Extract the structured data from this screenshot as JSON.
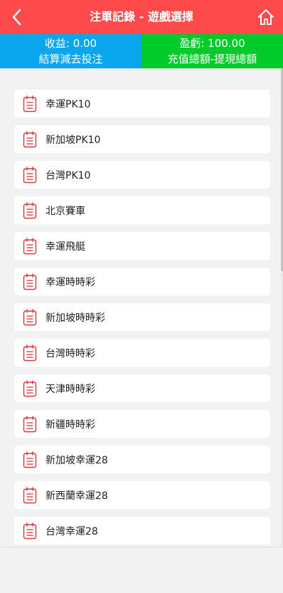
{
  "header": {
    "title": "注單記錄 - 遊戲選擇",
    "back_icon": "chevron-left-icon",
    "home_icon": "home-icon"
  },
  "stats": {
    "profit_label": "收益: 0.00",
    "profit_note": "結算減去投注",
    "balance_label": "盈虧: 100.00",
    "balance_note": "充值總額-提現總額"
  },
  "colors": {
    "header": "#fe4a4a",
    "profit_bg": "#0aa6ee",
    "balance_bg": "#00cb2b",
    "icon": "#d9363e"
  },
  "games": [
    {
      "label": "幸運PK10"
    },
    {
      "label": "新加坡PK10"
    },
    {
      "label": "台灣PK10"
    },
    {
      "label": "北京賽車"
    },
    {
      "label": "幸運飛艇"
    },
    {
      "label": "幸運時時彩"
    },
    {
      "label": "新加坡時時彩"
    },
    {
      "label": "台灣時時彩"
    },
    {
      "label": "天津時時彩"
    },
    {
      "label": "新疆時時彩"
    },
    {
      "label": "新加坡幸運28"
    },
    {
      "label": "新西蘭幸運28"
    },
    {
      "label": "台灣幸運28"
    }
  ]
}
